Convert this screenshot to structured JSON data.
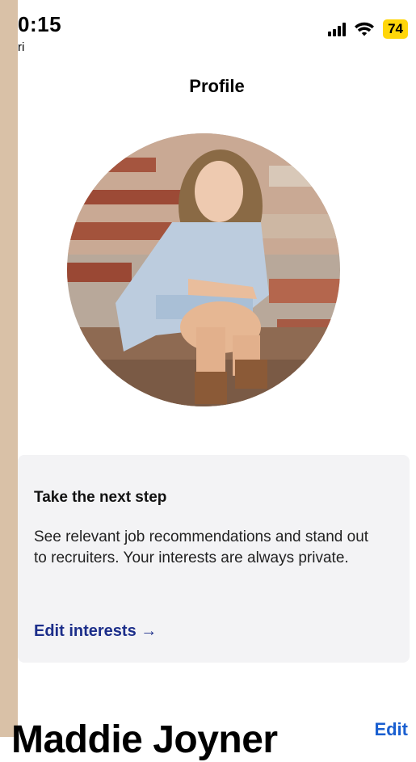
{
  "status_bar": {
    "time": "0:15",
    "carrier": "ri",
    "battery": "74"
  },
  "header": {
    "title": "Profile"
  },
  "next_step_card": {
    "title": "Take the next step",
    "body": "See relevant job recommendations and stand out to recruiters. Your interests are always private.",
    "link": "Edit interests →"
  },
  "profile": {
    "name": "Maddie Joyner",
    "edit_label": "Edit"
  },
  "colors": {
    "accent_link": "#1c2e8a",
    "edit_link": "#1a5fd0",
    "battery": "#ffd60a",
    "card_bg": "#f3f3f5"
  },
  "icons": [
    "signal-icon",
    "wifi-icon",
    "battery-icon"
  ]
}
